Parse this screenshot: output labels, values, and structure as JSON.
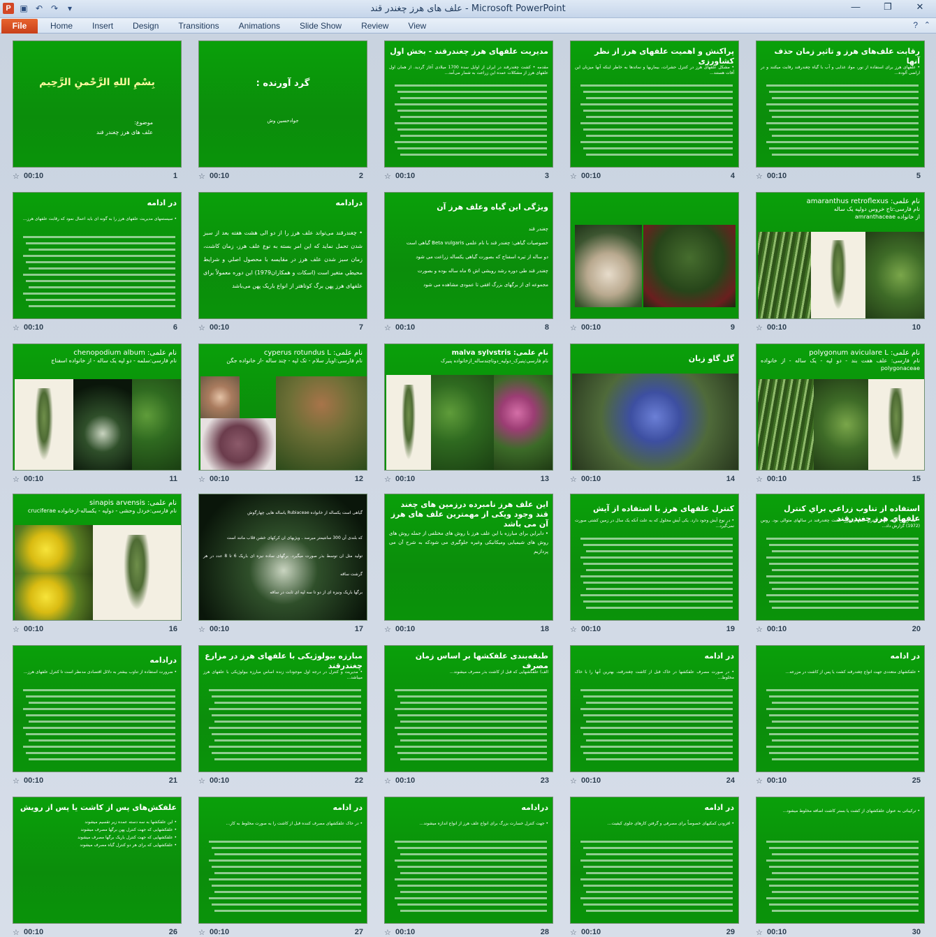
{
  "window": {
    "app_icon": "P",
    "title": "علف های هرز چغندر قند  -  Microsoft PowerPoint",
    "controls": [
      "minimize-icon",
      "restore-icon",
      "close-icon"
    ]
  },
  "ribbon": {
    "file_label": "File",
    "tabs": [
      "Home",
      "Insert",
      "Design",
      "Transitions",
      "Animations",
      "Slide Show",
      "Review",
      "View"
    ]
  },
  "qat_icons": [
    "save-icon",
    "undo-icon",
    "redo-icon",
    "customize-icon"
  ],
  "slide_time": "00:10",
  "slides": [
    {
      "num": "1",
      "title": "بِسْمِ اللهِ الرَّحْمنِ الرَّحِيم",
      "body": "موضوع:\nعلف های هرز چغندر قند"
    },
    {
      "num": "2",
      "title": "گرد آورنده :",
      "body": "جوادحسین وش"
    },
    {
      "num": "3",
      "title": "مدیریت علفهای هرز چغندرقند - بخش اول",
      "body": "مقدمه • کشت چغندرقند در ایران از اوایل سده 1700 میلادی آغاز گردید. از همان اول علفهای هرز از مشکلات عمده این زراعت به شمار می‌آمد..."
    },
    {
      "num": "4",
      "title": "پراکنش و اهمیت علفهای هرز از نظر کشاورزی",
      "body": "• مشکل علفهای هرز در کنترل حشرات، بیماریها و نماتدها به خاطر اینکه آنها میزبان این آفات هستند..."
    },
    {
      "num": "5",
      "title": "رقابت علف‌های هرز و تاثیر زمان حذف آنها",
      "body": "• علفهای هرز برای استفاده از نور، مواد غذایی و آب با گیاه چغندرقند رقابت میکنند و در اراضی آلوده..."
    },
    {
      "num": "6",
      "title": "در ادامه",
      "body": "• سیستمهای مدیریت علفهای هرز را به گونه ای باید اعمال نمود که رقابت علفهای هرز..."
    },
    {
      "num": "7",
      "title": "درادامه",
      "body": "• چغندرقند می‌تواند علف هرز را از دو الی هشت هفته بعد از سبز شدن تحمل نماید که این امر بسته به نوع علف هرز، زمان کاشت، زمان سبز شدن علف هرز در مقایسه با محصول اصلي و شرایط محیطي متغیر است (اسکات و همکاران1979) این دوره معمولاً برای علفهای هرز پهن برگ کوتاهتر از انواع باریک پهن می‌باشد"
    },
    {
      "num": "8",
      "title": "ویژگی این گیاه وعلف هرز آن",
      "body": "چغندر قند\nخصوصیات گیاهی: چغندر قند با نام علمی Beta vulgaris گیاهی است\nدو ساله از تیره اسفناج که بصورت گیاهی یکساله زراعت می شود\nچغندر قند طی دوره رشد رویشی اش 6 ماه ساله بوده و بصورت\nمجموعه ای از برگهای بزرگ افقی تا عمودی مشاهده می شود"
    },
    {
      "num": "9",
      "title": "",
      "body": ""
    },
    {
      "num": "10",
      "title": "نام علمی: amaranthus retroflexus",
      "body": "نام فارسی:تاج خروس دولپه یک ساله\nاز خانواده amranthaceae"
    },
    {
      "num": "11",
      "title": "نام علمی: chenopodium album",
      "body": "نام فارسی:سلمه - دو لپه یک ساله - از خانواده اسفناج"
    },
    {
      "num": "12",
      "title": "نام علمی: cyperus rotundus L",
      "body": "نام فارسی:اویار سلام - تک لپه - چند ساله -از خانواده جگن"
    },
    {
      "num": "13",
      "title": "نام علمی: malva sylvstris",
      "body": "نام فارسی:پنیرک_دولپه_دوتاچندساله_ازخانواده پنیرک"
    },
    {
      "num": "14",
      "title": "گل گاو زبان",
      "body": ""
    },
    {
      "num": "15",
      "title": "نام علمی: polygonum aviculare L",
      "body": "نام فارسی: علف هفت بند - دو لپه - یک ساله - از خانواده polygonaceae"
    },
    {
      "num": "16",
      "title": "نام علمی: sinapis arvensis",
      "body": "نام فارسی:خردل وحشی - دولپه - یکساله-ازخانواده cruciferae"
    },
    {
      "num": "17",
      "title": "گیاهی است یکساله از خانواده Rubiaceae یاساله هایی چهارگوش",
      "body": "که بلندی آن 300 سانتیمتر میرسد . ویژیهای ان کرکهای خشن قلاب مانند است\nتولید مثل ان توسط بذر صورت میگیرد. برگهای ساده نیزه ای باریک 6 تا 8 عدد در هر گرشت ساقه\nبرگها باریک ونیزه ای از دو تا سه لپه ای ثابت در ساقه"
    },
    {
      "num": "18",
      "title": "این علف هرز نامبرده درزمین های چغند قند وجود ویکی از مهمترین علف های هرز آن می باشد",
      "body": "• دابراین برای مبارزه با این علف هرز با روش های مختلفی از جمله روش های روش های شیمیایی ومیکانیکی وغیره جلوگیری می شودکه به شرح آن می پردازیم"
    },
    {
      "num": "19",
      "title": "کنترل علفهای هرز با استفاده از آیش",
      "body": "• در نوع آیش وجود دارد. یکی آیش محلول که به علت آنکه یک سال در زمین کشتی صورت نمی‌گیرد..."
    },
    {
      "num": "20",
      "title": "استفاده از تناوب زراعي براي كنترل علفهاي هرز چغندرقند",
      "body": "• یک روش اولیه جهت کنترل علفهای هرز، کشت چغندرقند در سالهای متوالی بود. روس (1972) گزارش داد..."
    },
    {
      "num": "21",
      "title": "درادامه",
      "body": "• ضرورت استفاده از تناوب بیشتر به دلائل اقتصادی مدنظر است تا کنترل علفهای هرز..."
    },
    {
      "num": "22",
      "title": "مبارزه بیولوژیکی با علفهای هرز در مزارع چغندرقند",
      "body": "• مدیریت و کنترل در درجه اول موجودات زنده اساس مبارزه بیولوژیکی با علفهای هرز میباشد..."
    },
    {
      "num": "23",
      "title": "طبقه‌بندی علفکشها بر اساس زمان مصرف",
      "body": "الف) علفکشهایی که قبل از کاشت بذر مصرف میشوند..."
    },
    {
      "num": "24",
      "title": "در ادامه",
      "body": "• در صورت مصرف علفکشها در خاک قبل از کاشت چغندرقند، بهترین آنها را با خاک مخلوط..."
    },
    {
      "num": "25",
      "title": "در ادامه",
      "body": "• علفکشهای متعددی جهت انواع چغندرقند کشت یا پس از کاشت در مزرعه..."
    },
    {
      "num": "26",
      "title": "علفکش‌های پس از کاشت یا پس از رویش",
      "body": "• این علفکشها به سه دسته عمده زیر تقسیم میشوند\n• علفکشهایی که جهت کنترل پهن برگها مصرف میشوند\n• علفکشهایی که جهت کنترل باریک برگها مصرف میشوند\n• علفکشهایی که برای هر دو کنترل گیاه مصرف میشوند"
    },
    {
      "num": "27",
      "title": "در ادامه",
      "body": "• در خاک علفکشهای مصرف کننده قبل از کاشت را به صورت مخلوط به کار..."
    },
    {
      "num": "28",
      "title": "درادامه",
      "body": "• جهت کنترل خسارت بزرگ برای انواع علف هرز از انواع اندازه میشوند..."
    },
    {
      "num": "29",
      "title": "در ادامه",
      "body": "• افزودن کمکیهای خصوصاً برای مصرفی و گرفتن کارهای جلوی کیفیت..."
    },
    {
      "num": "30",
      "title": "",
      "body": "• ترکیباتی به عنوان علفکشهای از کشت یا بستر کاشت اضافه مخلوط میشود..."
    }
  ]
}
